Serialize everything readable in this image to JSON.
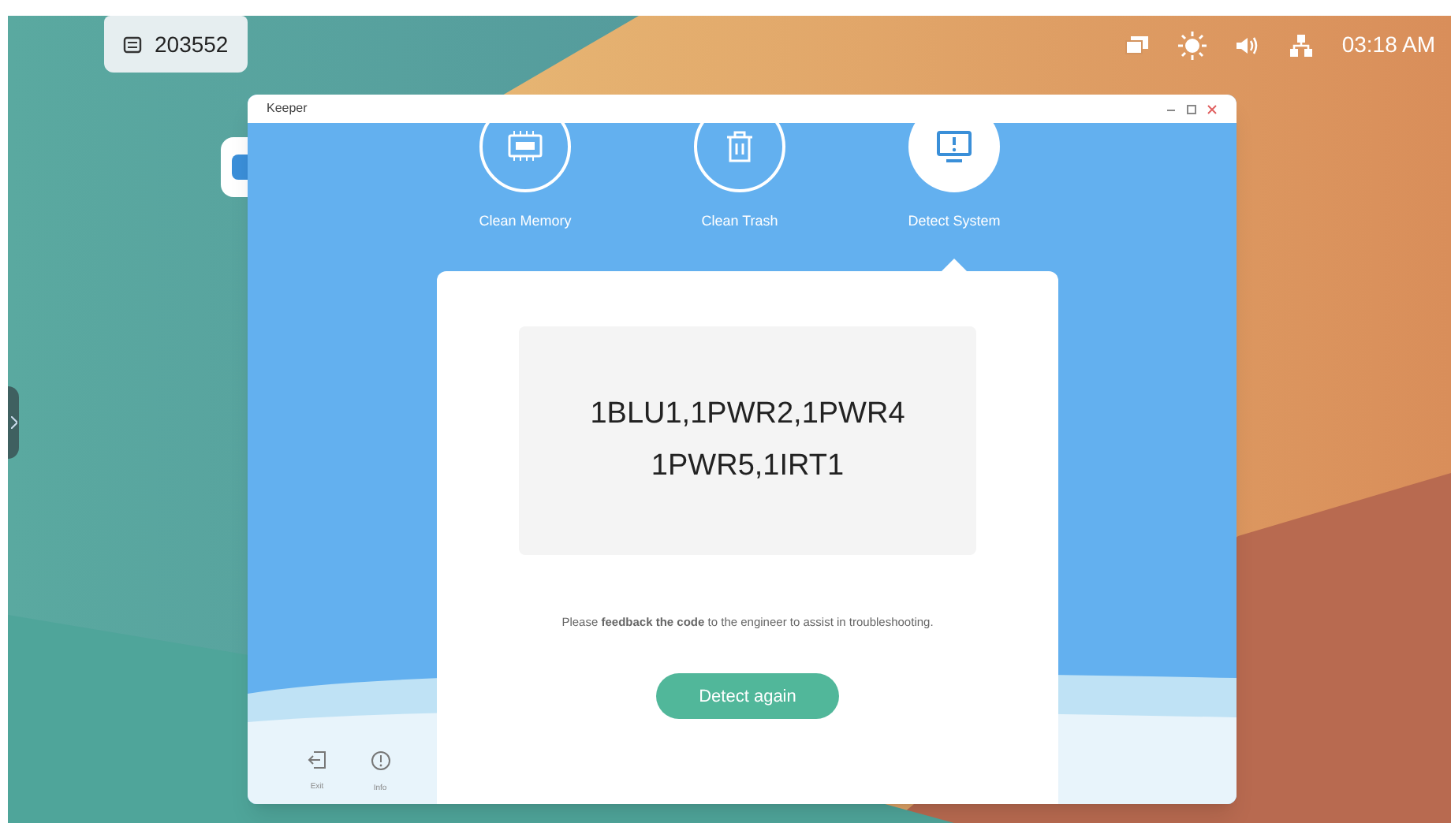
{
  "top_bar": {
    "badge_text": "203552",
    "time": "03:18 AM"
  },
  "window": {
    "title": "Keeper"
  },
  "tabs": [
    {
      "label": "Clean Memory",
      "selected": false
    },
    {
      "label": "Clean Trash",
      "selected": false
    },
    {
      "label": "Detect System",
      "selected": true
    }
  ],
  "result": {
    "code_lines": [
      "1BLU1,1PWR2,1PWR4",
      "1PWR5,1IRT1"
    ],
    "message": "Please **feedback the code** to the engineer to assist in troubleshooting.",
    "button": "Detect again"
  },
  "sidebar": [
    {
      "label": "Exit"
    },
    {
      "label": "Info"
    }
  ]
}
